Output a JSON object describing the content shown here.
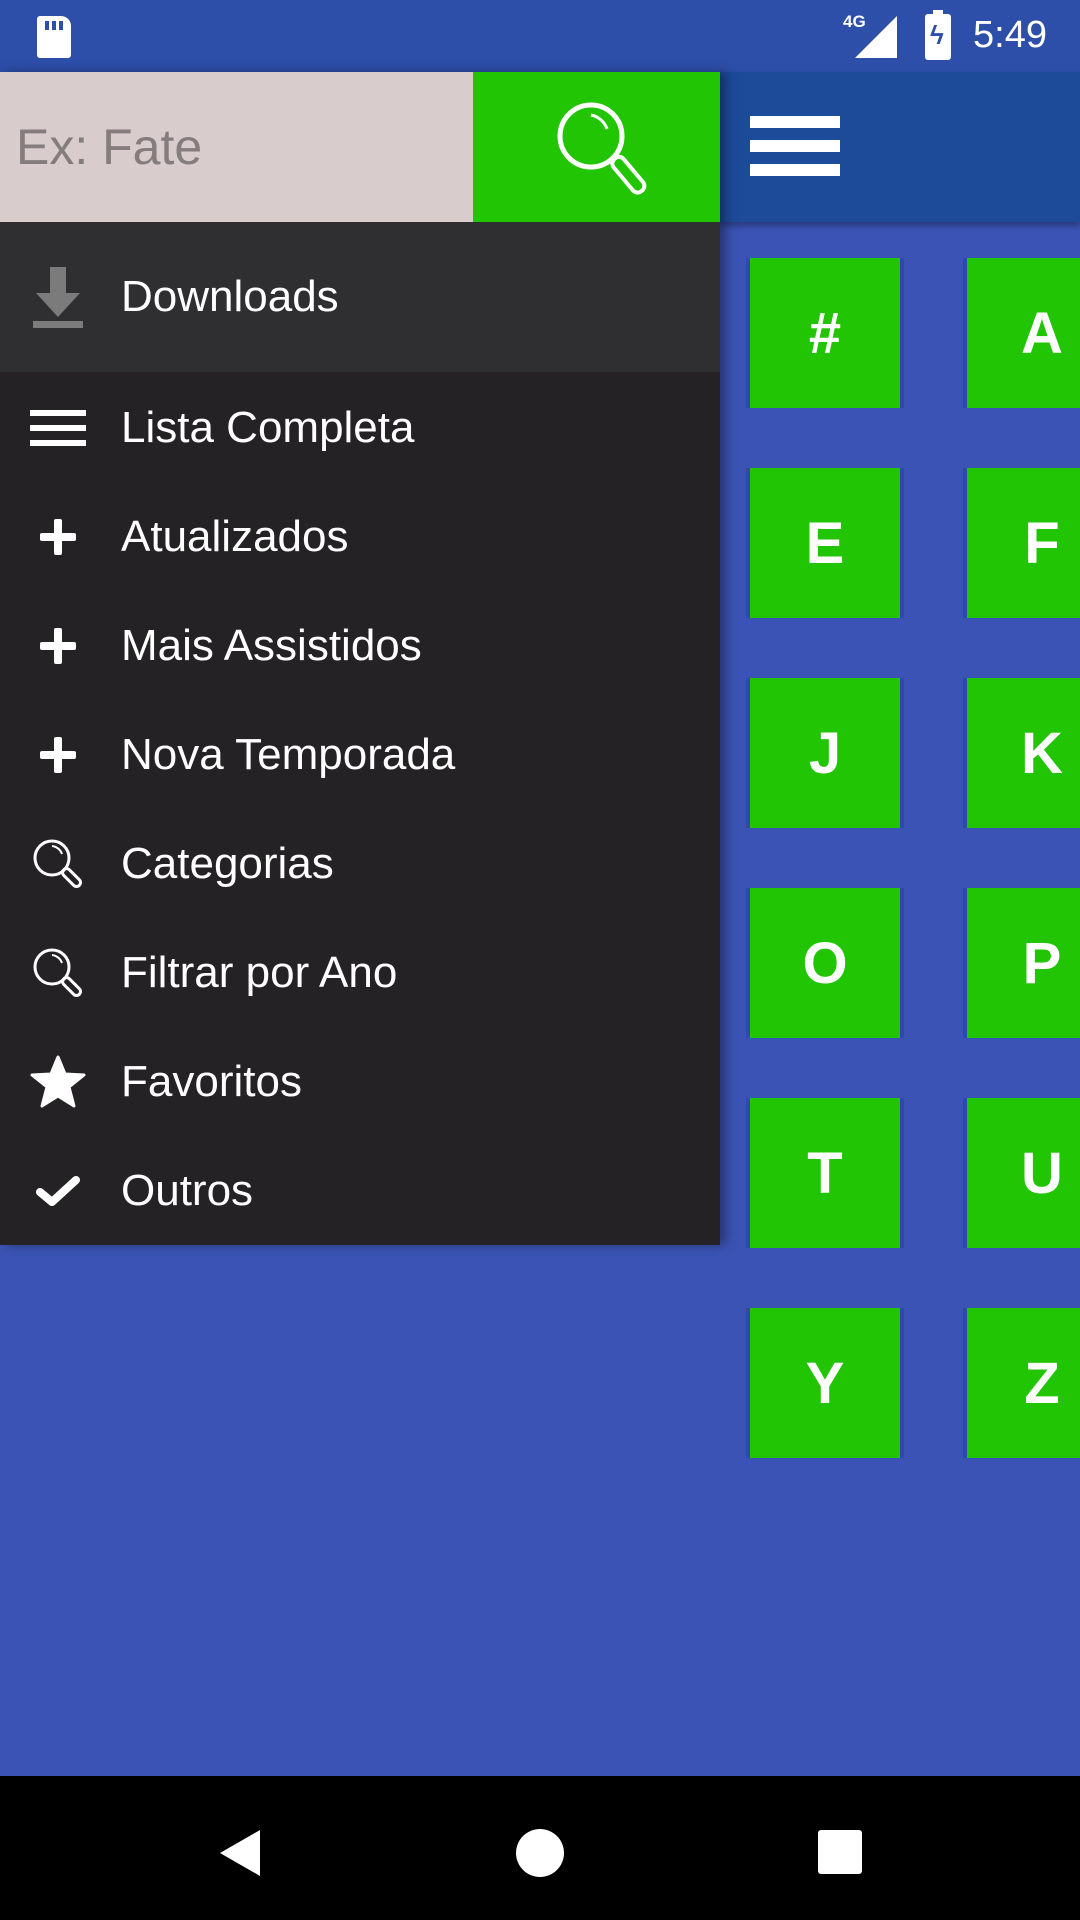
{
  "status_bar": {
    "time": "5:49",
    "network": "4G",
    "icons": [
      "sd-card-icon",
      "signal-icon",
      "battery-charging-icon"
    ]
  },
  "drawer": {
    "search": {
      "placeholder": "Ex: Fate",
      "value": ""
    },
    "downloads_label": "Downloads",
    "items": [
      {
        "label": "Lista Completa",
        "icon": "list-icon"
      },
      {
        "label": "Atualizados",
        "icon": "plus-icon"
      },
      {
        "label": "Mais Assistidos",
        "icon": "plus-icon"
      },
      {
        "label": "Nova Temporada",
        "icon": "plus-icon"
      },
      {
        "label": "Categorias",
        "icon": "search-icon"
      },
      {
        "label": "Filtrar por Ano",
        "icon": "search-icon"
      },
      {
        "label": "Favoritos",
        "icon": "star-icon"
      },
      {
        "label": "Outros",
        "icon": "check-icon"
      }
    ]
  },
  "letters": [
    "#",
    "A",
    "E",
    "F",
    "J",
    "K",
    "O",
    "P",
    "T",
    "U",
    "Y",
    "Z"
  ],
  "colors": {
    "accent_green": "#22c503",
    "background_blue": "#3b53b4",
    "header_blue": "#1e4a9a",
    "drawer_bg": "#242224"
  }
}
